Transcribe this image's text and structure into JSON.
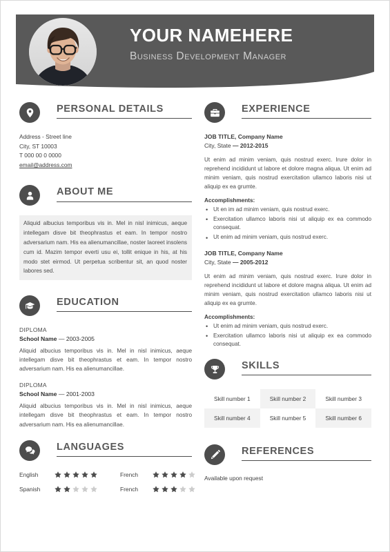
{
  "header": {
    "name": "YOUR NAMEHERE",
    "role": "Business Development Manager",
    "avatar_icon": "profile-photo",
    "bar_color": "#595959",
    "name_color": "#ffffff",
    "role_color": "#cfcfcf"
  },
  "left": {
    "personal_details": {
      "icon": "location-pin-icon",
      "title": "PERSONAL DETAILS",
      "address_line": "Address - Street line",
      "city_line": "City, ST 10003",
      "phone": "T 000 00 0 0000",
      "email": "email@address.com"
    },
    "about_me": {
      "icon": "person-icon",
      "title": "ABOUT ME",
      "text": "Aliquid albucius temporibus vis in. Mel in nisl inimicus, aeque intellegam disve bit theophrastus et eam. In tempor nostro adversarium nam. His ea alienumancillae, noster laoreet insolens cum id. Mazim tempor everti usu ei, tollit enique in his, at his modo stet eirmod. Ut perpetua scribentur sit, an quod noster labores sed."
    },
    "education": {
      "icon": "graduation-cap-icon",
      "title": "EDUCATION",
      "items": [
        {
          "degree": "DIPLOMA",
          "school": "School Name",
          "dates": "— 2003-2005",
          "description": "Aliquid albucius temporibus vis in. Mel in nisl inimicus, aeque intellegam disve bit theophrastus et eam. In tempor nostro adversarium nam. His ea alienumancillae."
        },
        {
          "degree": "DIPLOMA",
          "school": "School Name",
          "dates": "— 2001-2003",
          "description": "Aliquid albucius temporibus vis in. Mel in nisl inimicus, aeque intellegam disve bit theophrastus et eam. In tempor nostro adversarium nam. His ea alienumancillae."
        }
      ]
    },
    "languages": {
      "icon": "speech-bubble-icon",
      "title": "LANGUAGES",
      "items": [
        {
          "name": "English",
          "rating": 5,
          "max": 5
        },
        {
          "name": "French",
          "rating": 4,
          "max": 5
        },
        {
          "name": "Spanish",
          "rating": 2,
          "max": 5
        },
        {
          "name": "French",
          "rating": 3,
          "max": 5
        }
      ]
    }
  },
  "right": {
    "experience": {
      "icon": "briefcase-icon",
      "title": "EXPERIENCE",
      "accomplishments_label": "Accomplishments:",
      "jobs": [
        {
          "title": "JOB TITLE, Company Name",
          "location": "City, State",
          "dates": "— 2012-2015",
          "description": "Ut enim ad minim veniam, quis nostrud exerc. Irure dolor in reprehend incididunt ut labore et dolore magna aliqua. Ut enim ad minim veniam, quis nostrud exercitation ullamco laboris nisi ut aliquip ex ea grumte.",
          "bullets": [
            "Ut en im ad minim veniam, quis nostrud exerc.",
            "Exercitation ullamco laboris nisi ut aliquip ex ea commodo consequat.",
            "Ut enim ad minim veniam, quis nostrud exerc."
          ]
        },
        {
          "title": "JOB TITLE, Company Name",
          "location": "City, State",
          "dates": "— 2005-2012",
          "description": "Ut enim ad minim veniam, quis nostrud exerc. Irure dolor in reprehend incididunt ut labore et dolore magna aliqua. Ut enim ad minim veniam, quis nostrud exercitation ullamco laboris nisi ut aliquip ex ea grumte.",
          "bullets": [
            "Ut enim ad minim veniam, quis nostrud exerc.",
            "Exercitation ullamco laboris nisi ut aliquip ex ea commodo consequat."
          ]
        }
      ]
    },
    "skills": {
      "icon": "trophy-icon",
      "title": "SKILLS",
      "items": [
        "Skill number 1",
        "Skill number 2",
        "Skill number 3",
        "Skill number 4",
        "Skill number 5",
        "Skill number 6"
      ]
    },
    "references": {
      "icon": "pencil-icon",
      "title": "REFERENCES",
      "text": "Available upon request"
    }
  },
  "theme": {
    "dark": "#4d4d4d",
    "header_gray": "#595959",
    "star_filled": "#4d4d4d",
    "star_empty": "#cccccc",
    "shade": "#f2f2f2"
  }
}
